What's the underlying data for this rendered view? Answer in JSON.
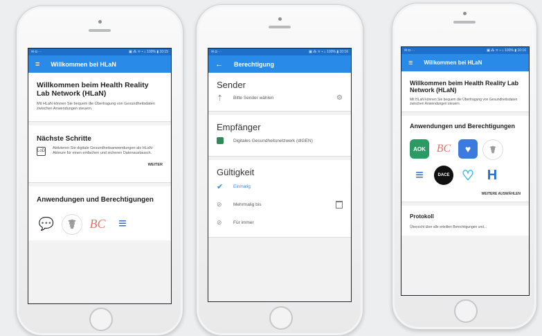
{
  "phone1": {
    "status": {
      "left": "✉ ◘ ⋯",
      "right": "▣ ⁂ ᯤ ▪ ⌂ 100% ▮ 10:15"
    },
    "appbar": {
      "menu": "≡",
      "title": "Willkommen bei HLaN"
    },
    "welcome": {
      "title": "Willkommen beim Health Reality Lab Network (HLaN)",
      "text": "Mit HLaN können Sie bequem die Übertragung von Gesundheitsdaten zwischen Anwendungen steuern."
    },
    "next": {
      "title": "Nächste Schritte",
      "text": "Aktivieren Sie digitale Gesundheitsanwendungen als HLaN-Akteure für einen einfachen und sicheren Datenaustausch.",
      "button": "WEITER"
    },
    "apps": {
      "title": "Anwendungen und Berechtigungen"
    }
  },
  "phone2": {
    "status": {
      "left": "✉ ◘ ⋯",
      "right": "▣ ⁂ ᯤ ▪ ⌂ 100% ▮ 10:16"
    },
    "appbar": {
      "back": "←",
      "title": "Berechtigung"
    },
    "sender": {
      "title": "Sender",
      "placeholder": "Bitte Sender wählen"
    },
    "receiver": {
      "title": "Empfänger",
      "name": "Digitales Gesundheitsnetzwerk (dIGEN)"
    },
    "validity": {
      "title": "Gültigkeit",
      "options": [
        "Einmalig",
        "Mehrmalig bis",
        "Für immer"
      ]
    }
  },
  "phone3": {
    "status": {
      "left": "✉ ◘ ⋯",
      "right": "▣ ⁂ ᯤ ▪ ⌂ 100% ▮ 10:16"
    },
    "appbar": {
      "menu": "≡",
      "title": "Willkommen bei HLaN"
    },
    "welcome": {
      "title": "Willkommen beim Health Reality Lab Network (HLaN)",
      "text": "Mit HLaN können Sie bequem die Übertragung von Gesundheitsdaten zwischen Anwendungen steuern."
    },
    "apps": {
      "title": "Anwendungen und Berechtigungen",
      "button": "WEITERE AUSWÄHLEN",
      "icons": [
        "AOK",
        "BC",
        "♥",
        "☤",
        "≡",
        "DACE",
        "♡",
        "H"
      ]
    },
    "log": {
      "title": "Protokoll",
      "text": "Übersicht über alle erteilten Berechtigungen und..."
    }
  },
  "colors": {
    "appbar": "#2a8ae8",
    "statusbar": "#1e6fc9",
    "check": "#2a8ae8"
  }
}
